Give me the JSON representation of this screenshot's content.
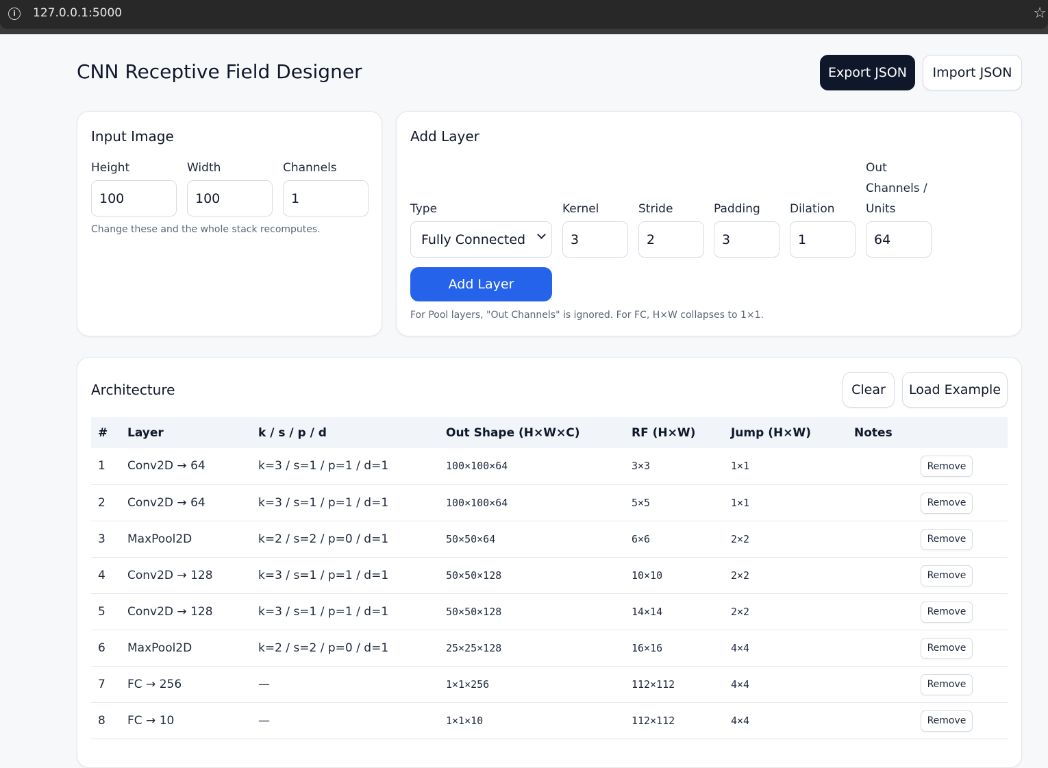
{
  "browser": {
    "url": "127.0.0.1:5000"
  },
  "header": {
    "title": "CNN Receptive Field Designer",
    "export_label": "Export JSON",
    "import_label": "Import JSON"
  },
  "input_image": {
    "title": "Input Image",
    "height_label": "Height",
    "width_label": "Width",
    "channels_label": "Channels",
    "height": "100",
    "width": "100",
    "channels": "1",
    "hint": "Change these and the whole stack recomputes."
  },
  "add_layer": {
    "title": "Add Layer",
    "type_label": "Type",
    "kernel_label": "Kernel",
    "stride_label": "Stride",
    "padding_label": "Padding",
    "dilation_label": "Dilation",
    "out_label_1": "Out",
    "out_label_2": "Channels /",
    "out_label_3": "Units",
    "type_value": "Fully Connected",
    "kernel": "3",
    "stride": "2",
    "padding": "3",
    "dilation": "1",
    "out_channels": "64",
    "button_label": "Add Layer",
    "hint": "For Pool layers, \"Out Channels\" is ignored. For FC, H×W collapses to 1×1."
  },
  "architecture": {
    "title": "Architecture",
    "clear_label": "Clear",
    "load_example_label": "Load Example",
    "columns": [
      "#",
      "Layer",
      "k / s / p / d",
      "Out Shape (H×W×C)",
      "RF (H×W)",
      "Jump (H×W)",
      "Notes"
    ],
    "remove_label": "Remove",
    "rows": [
      {
        "num": "1",
        "layer": "Conv2D → 64",
        "params": "k=3 / s=1 / p=1 / d=1",
        "shape": "100×100×64",
        "rf": "3×3",
        "jump": "1×1"
      },
      {
        "num": "2",
        "layer": "Conv2D → 64",
        "params": "k=3 / s=1 / p=1 / d=1",
        "shape": "100×100×64",
        "rf": "5×5",
        "jump": "1×1"
      },
      {
        "num": "3",
        "layer": "MaxPool2D",
        "params": "k=2 / s=2 / p=0 / d=1",
        "shape": "50×50×64",
        "rf": "6×6",
        "jump": "2×2"
      },
      {
        "num": "4",
        "layer": "Conv2D → 128",
        "params": "k=3 / s=1 / p=1 / d=1",
        "shape": "50×50×128",
        "rf": "10×10",
        "jump": "2×2"
      },
      {
        "num": "5",
        "layer": "Conv2D → 128",
        "params": "k=3 / s=1 / p=1 / d=1",
        "shape": "50×50×128",
        "rf": "14×14",
        "jump": "2×2"
      },
      {
        "num": "6",
        "layer": "MaxPool2D",
        "params": "k=2 / s=2 / p=0 / d=1",
        "shape": "25×25×128",
        "rf": "16×16",
        "jump": "4×4"
      },
      {
        "num": "7",
        "layer": "FC → 256",
        "params": "—",
        "shape": "1×1×256",
        "rf": "112×112",
        "jump": "4×4"
      },
      {
        "num": "8",
        "layer": "FC → 10",
        "params": "—",
        "shape": "1×1×10",
        "rf": "112×112",
        "jump": "4×4"
      }
    ]
  }
}
